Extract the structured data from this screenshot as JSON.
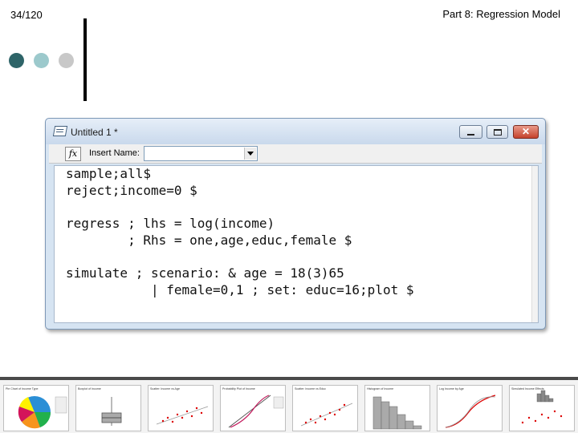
{
  "slide": {
    "number": "34/120",
    "title": "Part 8: Regression Model"
  },
  "window": {
    "title": "Untitled 1 *",
    "close_glyph": "✕",
    "insert_label": "Insert Name:",
    "insert_value": "",
    "fx_label": "fx"
  },
  "code": [
    "sample;all$",
    "reject;income=0 $",
    "",
    "regress ; lhs = log(income)",
    "        ; Rhs = one,age,educ,female $",
    "",
    "simulate ; scenario: & age = 18(3)65",
    "           | female=0,1 ; set: educ=16;plot $"
  ],
  "thumbnails": [
    {
      "caption": "Pie Chart of Income Type"
    },
    {
      "caption": "Boxplot of Income"
    },
    {
      "caption": "Scatter: Income vs Age"
    },
    {
      "caption": "Probability Plot of Income"
    },
    {
      "caption": "Scatter: Income vs Educ"
    },
    {
      "caption": "Histogram of Income"
    },
    {
      "caption": "Log Income by Age"
    },
    {
      "caption": "Simulated Income Effects"
    }
  ],
  "colors": {
    "dot_dark": "#2e6468",
    "dot_mid": "#9cc9cc",
    "dot_light": "#c8c8c8",
    "close_red": "#c4412c"
  }
}
